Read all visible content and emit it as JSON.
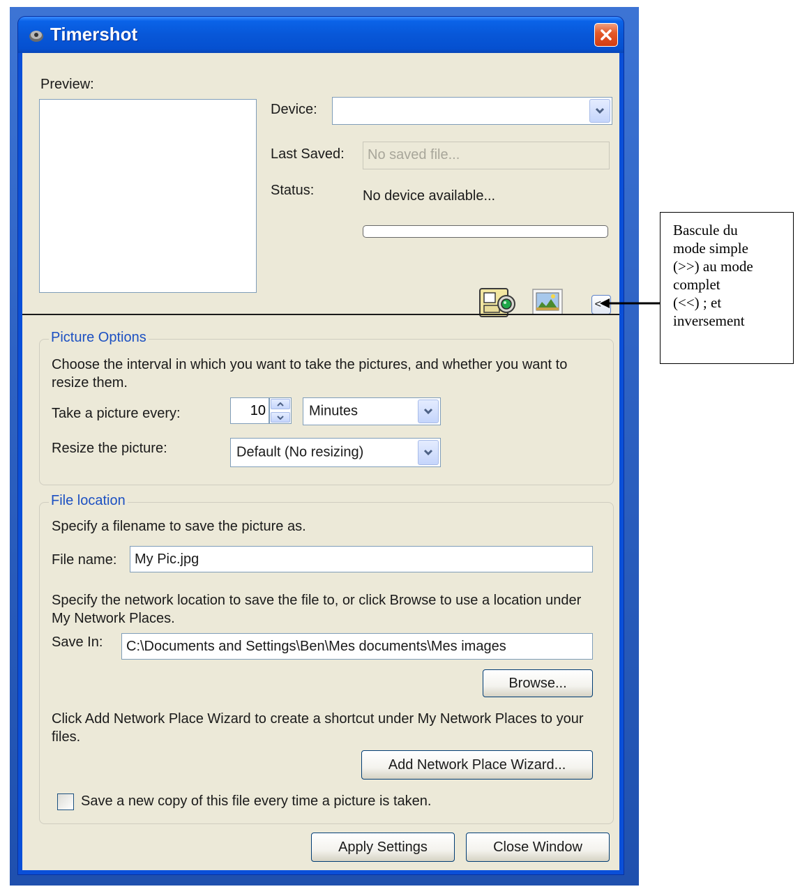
{
  "window": {
    "title": "Timershot"
  },
  "preview": {
    "label": "Preview:"
  },
  "device": {
    "label": "Device:",
    "value": ""
  },
  "last_saved": {
    "label": "Last Saved:",
    "value": "No saved file..."
  },
  "status": {
    "label": "Status:",
    "value": "No device available..."
  },
  "progress": {
    "value": 0
  },
  "toolbar": {
    "toggle_label": "<<"
  },
  "picture_options": {
    "legend": "Picture Options",
    "description": "Choose the interval in which you want to take the pictures, and whether you want to resize them.",
    "interval_label": "Take a picture every:",
    "interval_value": "10",
    "interval_unit": "Minutes",
    "resize_label": "Resize the picture:",
    "resize_value": "Default (No resizing)"
  },
  "file_location": {
    "legend": "File location",
    "filename_desc": "Specify a filename to save the picture as.",
    "filename_label": "File name:",
    "filename_value": "My Pic.jpg",
    "network_desc": "Specify the network location to save the file to, or click Browse to use a location under My Network Places.",
    "save_in_label": "Save In:",
    "save_in_value": "C:\\Documents and Settings\\Ben\\Mes documents\\Mes images",
    "browse_label": "Browse...",
    "wizard_desc": "Click Add Network Place Wizard to create a shortcut under My Network Places to your files.",
    "wizard_label": "Add Network Place Wizard...",
    "new_copy_label": "Save a new copy of this file every time a picture is taken.",
    "new_copy_checked": false
  },
  "buttons": {
    "apply": "Apply Settings",
    "close": "Close Window"
  },
  "annotation": {
    "text": "Bascule du\nmode simple\n(>>) au mode\ncomplet\n(<<) ; et\ninversement"
  },
  "colors": {
    "title_bar": "#0a56d6",
    "dialog_bg": "#ece9d8",
    "group_legend": "#1c50c2",
    "close_button": "#d9451a"
  }
}
